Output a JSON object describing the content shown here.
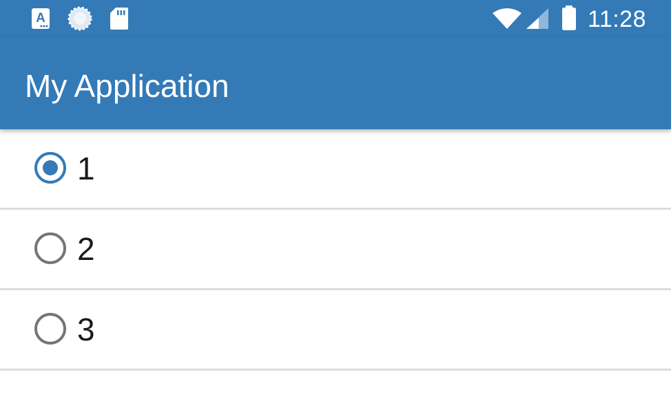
{
  "status_bar": {
    "time": "11:28",
    "icons": [
      "text-notification-icon",
      "sync-icon",
      "sd-card-icon",
      "wifi-icon",
      "signal-icon",
      "battery-icon"
    ]
  },
  "app_bar": {
    "title": "My Application"
  },
  "colors": {
    "primary": "#337ab7",
    "radio_unchecked": "#757575",
    "divider": "#dcdcdc"
  },
  "radio_group": {
    "options": [
      {
        "label": "1",
        "checked": true
      },
      {
        "label": "2",
        "checked": false
      },
      {
        "label": "3",
        "checked": false
      }
    ]
  }
}
